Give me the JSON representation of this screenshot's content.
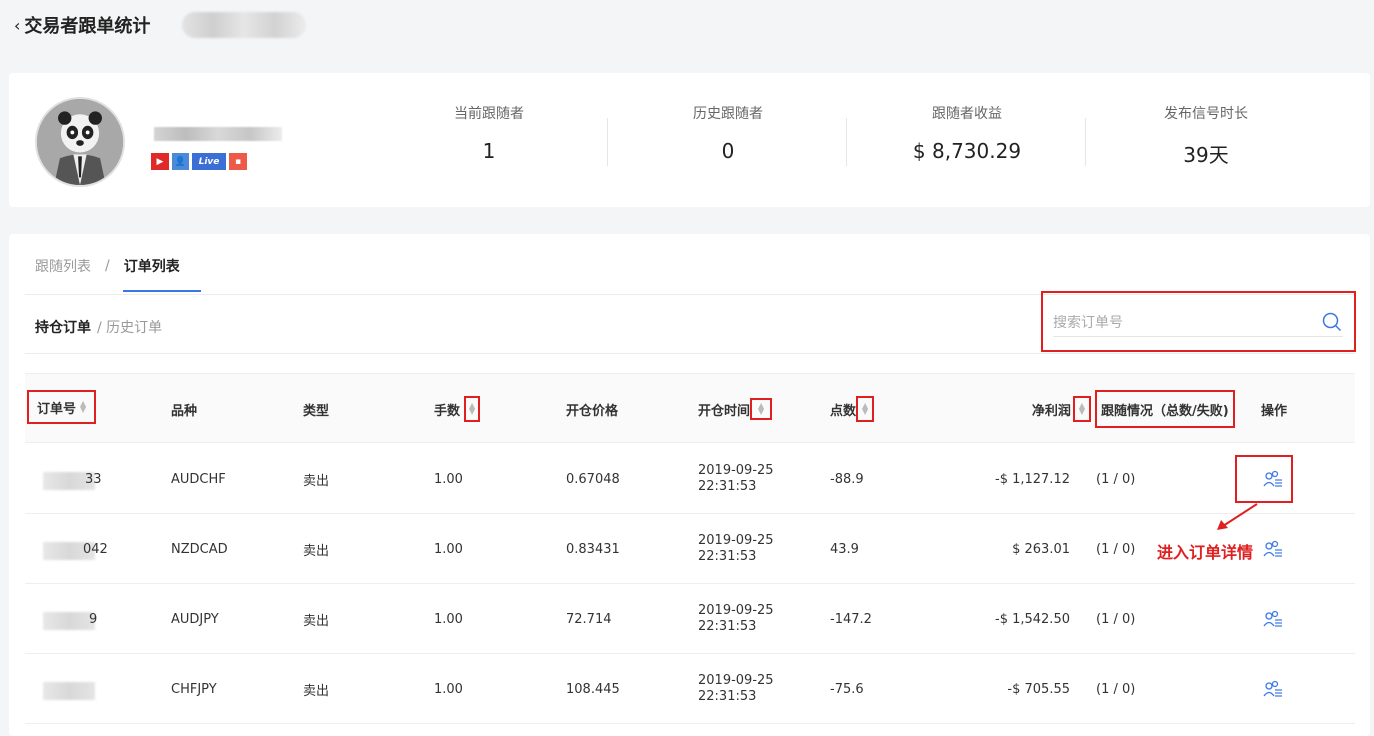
{
  "header": {
    "title": "交易者跟单统计",
    "back_glyph": "‹"
  },
  "profile": {
    "badges": [
      "▶",
      "👤",
      "Live",
      "▪"
    ],
    "stats": [
      {
        "label": "当前跟随者",
        "value": "1"
      },
      {
        "label": "历史跟随者",
        "value": "0"
      },
      {
        "label": "跟随者收益",
        "value": "$ 8,730.29"
      },
      {
        "label": "发布信号时长",
        "value": "39天"
      }
    ]
  },
  "tabs": {
    "follow_list": "跟随列表",
    "separator": "/",
    "order_list": "订单列表"
  },
  "subtabs": {
    "open": "持仓订单",
    "history": "/ 历史订单"
  },
  "search": {
    "placeholder": "搜索订单号",
    "icon": "search-icon"
  },
  "table": {
    "headers": {
      "order_id": "订单号",
      "symbol": "品种",
      "type": "类型",
      "lots": "手数",
      "open_price": "开仓价格",
      "open_time": "开仓时间",
      "points": "点数",
      "net_profit": "净利润",
      "follow": "跟随情况（总数/失败)",
      "action": "操作"
    },
    "rows": [
      {
        "id_suffix": "33",
        "symbol": "AUDCHF",
        "type": "卖出",
        "lots": "1.00",
        "price": "0.67048",
        "date": "2019-09-25",
        "time": "22:31:53",
        "points": "-88.9",
        "profit": "-$ 1,127.12",
        "follow": "(1 / 0)"
      },
      {
        "id_suffix": "042",
        "symbol": "NZDCAD",
        "type": "卖出",
        "lots": "1.00",
        "price": "0.83431",
        "date": "2019-09-25",
        "time": "22:31:53",
        "points": "43.9",
        "profit": "$ 263.01",
        "follow": "(1 / 0)"
      },
      {
        "id_suffix": "9",
        "symbol": "AUDJPY",
        "type": "卖出",
        "lots": "1.00",
        "price": "72.714",
        "date": "2019-09-25",
        "time": "22:31:53",
        "points": "-147.2",
        "profit": "-$ 1,542.50",
        "follow": "(1 / 0)"
      },
      {
        "id_suffix": "",
        "symbol": "CHFJPY",
        "type": "卖出",
        "lots": "1.00",
        "price": "108.445",
        "date": "2019-09-25",
        "time": "22:31:53",
        "points": "-75.6",
        "profit": "-$ 705.55",
        "follow": "(1 / 0)"
      }
    ]
  },
  "annotation": {
    "text": "进入订单详情"
  },
  "colors": {
    "accent": "#3a78e6",
    "highlight": "#e02020",
    "icon": "#3a78e6"
  }
}
